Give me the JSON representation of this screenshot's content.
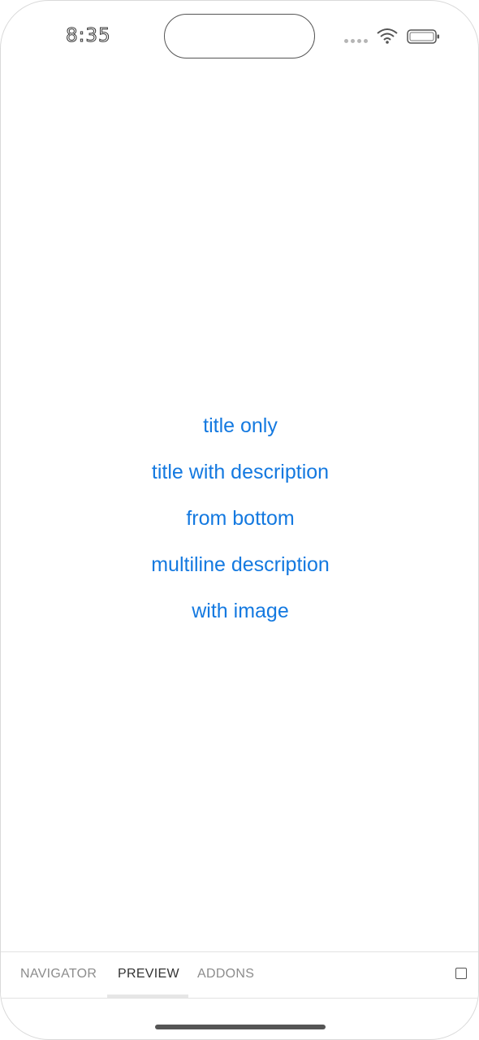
{
  "status_bar": {
    "time": "8:35"
  },
  "menu": {
    "items": [
      {
        "label": "title only"
      },
      {
        "label": "title with description"
      },
      {
        "label": "from bottom"
      },
      {
        "label": "multiline description"
      },
      {
        "label": "with image"
      }
    ]
  },
  "addon_bar": {
    "tabs": [
      {
        "label": "NAVIGATOR",
        "active": false
      },
      {
        "label": "PREVIEW",
        "active": true
      },
      {
        "label": "ADDONS",
        "active": false
      }
    ]
  },
  "colors": {
    "link": "#1479e0",
    "tab_active": "#333333",
    "tab_inactive": "#8c8c8c"
  }
}
